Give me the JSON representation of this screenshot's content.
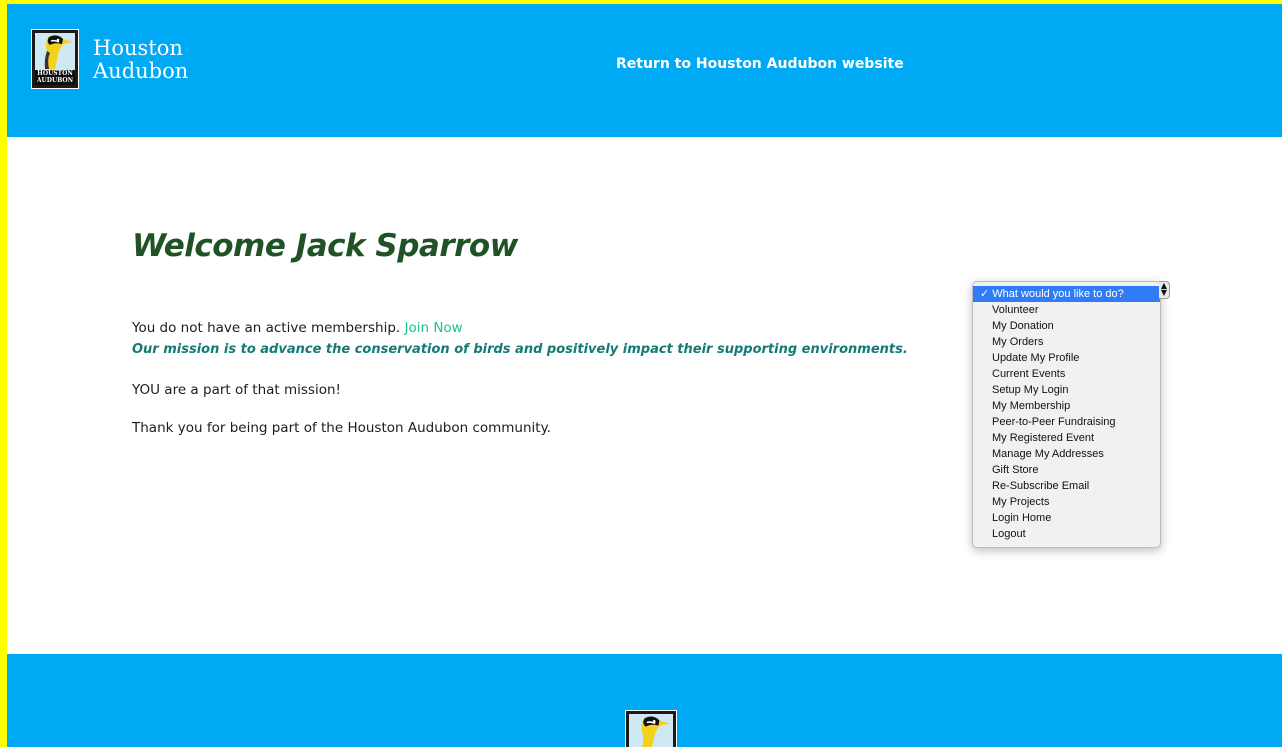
{
  "header": {
    "logo_line1": "Houston",
    "logo_line2": "Audubon",
    "badge_text_line1": "HOUSTON",
    "badge_text_line2": "AUDUBON",
    "return_link": "Return to Houston Audubon website"
  },
  "main": {
    "welcome": "Welcome Jack Sparrow",
    "membership_text": "You do not have an active membership.",
    "join_link": "Join Now",
    "mission": "Our mission is to advance the conservation of birds and positively impact their supporting environments.",
    "part_of_mission": "YOU are a part of that mission!",
    "thanks": "Thank you for being part of the Houston Audubon community."
  },
  "action_menu": {
    "selected": "What would you like to do?",
    "options": [
      "Volunteer",
      "My Donation",
      "My Orders",
      "Update My Profile",
      "Current Events",
      "Setup My Login",
      "My Membership",
      "Peer-to-Peer Fundraising",
      "My Registered Event",
      "Manage My Addresses",
      "Gift Store",
      "Re-Subscribe Email",
      "My Projects",
      "Login Home",
      "Logout"
    ]
  },
  "colors": {
    "header_bg": "#00a9f4",
    "outer_frame": "#ffff00",
    "welcome_green": "#1f5326",
    "mission_teal": "#137a78",
    "link_green": "#1ec285",
    "selected_blue": "#2f7cf6"
  }
}
